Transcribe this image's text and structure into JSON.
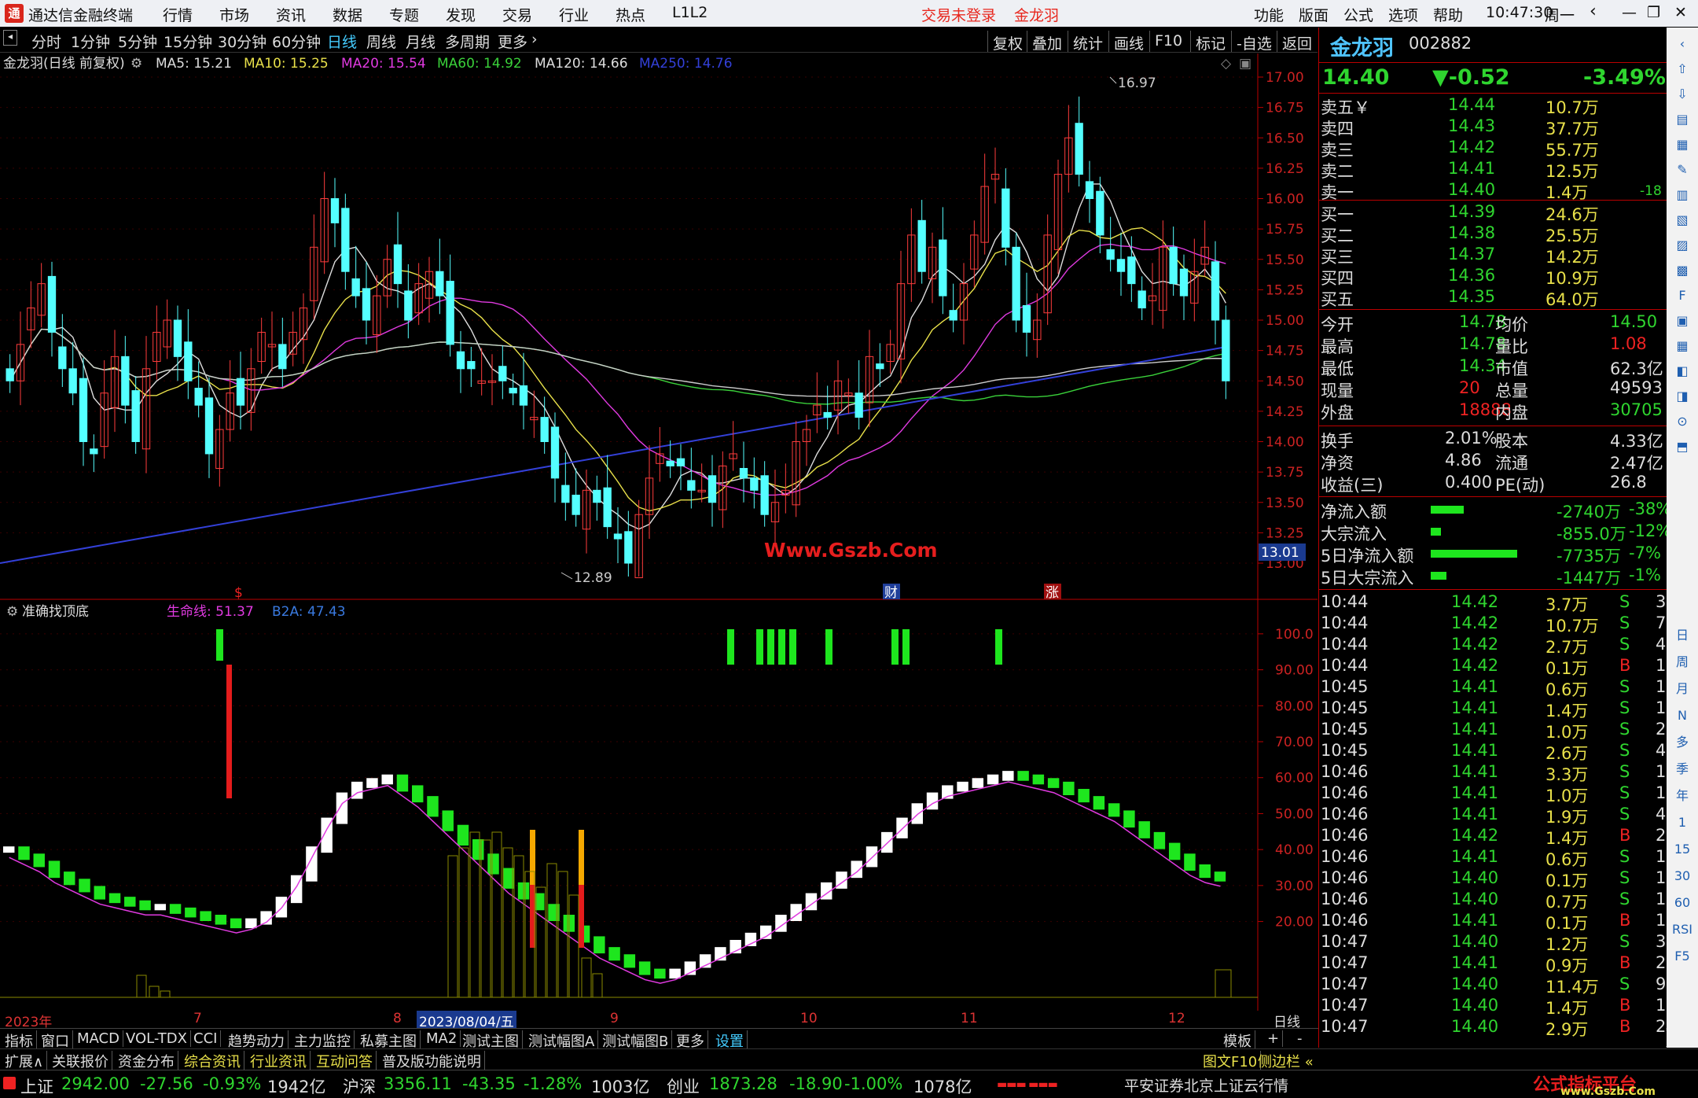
{
  "titlebar": {
    "app_title": "通达信金融终端",
    "menu": [
      "行情",
      "市场",
      "资讯",
      "数据",
      "专题",
      "发现",
      "交易",
      "行业",
      "热点",
      "L1L2"
    ],
    "login_status": "交易未登录",
    "stock_name": "金龙羽",
    "right_menu": [
      "功能",
      "版面",
      "公式",
      "选项",
      "帮助"
    ],
    "time": "10:47:30",
    "weekday": "周一"
  },
  "periods": [
    "分时",
    "1分钟",
    "5分钟",
    "15分钟",
    "30分钟",
    "60分钟",
    "日线",
    "周线",
    "月线",
    "多周期",
    "更多"
  ],
  "active_period": "日线",
  "toolbar_buttons": [
    "复权",
    "叠加",
    "统计",
    "画线",
    "F10",
    "标记",
    "-自选",
    "返回"
  ],
  "main_header": {
    "name": "金龙羽(日线 前复权)",
    "ma5": "MA5: 15.21",
    "ma10": "MA10: 15.25",
    "ma20": "MA20: 15.54",
    "ma60": "MA60: 14.92",
    "ma120": "MA120: 14.66",
    "ma250": "MA250: 14.76"
  },
  "y_axis_main": [
    "17.00",
    "16.75",
    "16.50",
    "16.25",
    "16.00",
    "15.75",
    "15.50",
    "15.25",
    "15.00",
    "14.75",
    "14.50",
    "14.25",
    "14.00",
    "13.75",
    "13.50",
    "13.25",
    "13.00"
  ],
  "price_marks": {
    "high": "16.97",
    "low": "12.89",
    "current": "13.01"
  },
  "watermark": "Www.Gszb.Com",
  "markers": {
    "m1": "$",
    "m2": "财",
    "m3": "涨"
  },
  "ind_header": {
    "name": "准确找顶底",
    "line1": "生命线: 51.37",
    "line2": "B2A: 47.43"
  },
  "y_axis_ind": [
    "100.0",
    "90.00",
    "80.00",
    "70.00",
    "60.00",
    "50.00",
    "40.00",
    "30.00",
    "20.00"
  ],
  "date_axis": {
    "year": "2023年",
    "months": [
      "7",
      "8",
      "9",
      "10",
      "11",
      "12"
    ],
    "cursor_date": "2023/08/04/五",
    "period_label": "日线"
  },
  "bottom_tabs": [
    "指标",
    "窗口",
    "MACD",
    "VOL-TDX",
    "CCI",
    "趋势动力",
    "主力监控",
    "私募主图",
    "MA2",
    "测试主图",
    "测试幅图A",
    "测试幅图B",
    "更多",
    "设置"
  ],
  "bottom_right": [
    "模板",
    "+",
    "-"
  ],
  "tabs2": [
    "扩展∧",
    "关联报价",
    "资金分布",
    "综合资讯",
    "行业资讯",
    "互动问答",
    "普及版功能说明"
  ],
  "tabs2_right": [
    "图文F10",
    "侧边栏 «"
  ],
  "quote_tabs": [
    "笔",
    "价",
    "细",
    "势",
    "联"
  ],
  "status": {
    "sh_label": "上证",
    "sh_val": "2942.00",
    "sh_chg": "-27.56",
    "sh_pct": "-0.93%",
    "sh_amt": "1942亿",
    "hs_label": "沪深",
    "hs_val": "3356.11",
    "hs_chg": "-43.35",
    "hs_pct": "-1.28%",
    "hs_amt": "1003亿",
    "cy_label": "创业",
    "cy_val": "1873.28",
    "cy_chg": "-18.90",
    "cy_pct": "-1.00%",
    "cy_amt": "1078亿",
    "broker": "平安证券北京上证云行情",
    "logo_text": "公式指标平台",
    "logo_url": "www.Gszb.Com"
  },
  "quote": {
    "name": "金龙羽",
    "code": "002882",
    "price": "14.40",
    "change": "▼-0.52",
    "pct": "-3.49%",
    "asks": [
      {
        "label": "卖五￥",
        "price": "14.44",
        "vol": "10.7万"
      },
      {
        "label": "卖四",
        "price": "14.43",
        "vol": "37.7万"
      },
      {
        "label": "卖三",
        "price": "14.42",
        "vol": "55.7万"
      },
      {
        "label": "卖二",
        "price": "14.41",
        "vol": "12.5万"
      },
      {
        "label": "卖一",
        "price": "14.40",
        "vol": "1.4万",
        "extra": "-18"
      }
    ],
    "bids": [
      {
        "label": "买一",
        "price": "14.39",
        "vol": "24.6万"
      },
      {
        "label": "买二",
        "price": "14.38",
        "vol": "25.5万"
      },
      {
        "label": "买三",
        "price": "14.37",
        "vol": "14.2万"
      },
      {
        "label": "买四",
        "price": "14.36",
        "vol": "10.9万"
      },
      {
        "label": "买五",
        "price": "14.35",
        "vol": "64.0万"
      }
    ],
    "stats": [
      [
        "今开",
        "14.78",
        "均价",
        "14.50"
      ],
      [
        "最高",
        "14.78",
        "量比",
        "1.08"
      ],
      [
        "最低",
        "14.34",
        "市值",
        "62.3亿"
      ],
      [
        "现量",
        "20",
        "总量",
        "49593"
      ],
      [
        "外盘",
        "18888",
        "内盘",
        "30705"
      ]
    ],
    "stats2": [
      [
        "换手",
        "2.01%",
        "股本",
        "4.33亿"
      ],
      [
        "净资",
        "4.86",
        "流通",
        "2.47亿"
      ],
      [
        "收益(三)",
        "0.400",
        "PE(动)",
        "26.8"
      ]
    ],
    "flows": [
      {
        "label": "净流入额",
        "val": "-2740万",
        "pct": "-38%",
        "bar": 0.38
      },
      {
        "label": "大宗流入",
        "val": "-855.0万",
        "pct": "-12%",
        "bar": 0.12
      },
      {
        "label": "5日净流入额",
        "val": "-7735万",
        "pct": "-7%",
        "bar": 1.0
      },
      {
        "label": "5日大宗流入",
        "val": "-1447万",
        "pct": "-1%",
        "bar": 0.18
      }
    ],
    "ticks": [
      [
        "10:44",
        "14.42",
        "3.7万",
        "S",
        "3"
      ],
      [
        "10:44",
        "14.42",
        "10.7万",
        "S",
        "7"
      ],
      [
        "10:44",
        "14.42",
        "2.7万",
        "S",
        "4"
      ],
      [
        "10:44",
        "14.42",
        "0.1万",
        "B",
        "1"
      ],
      [
        "10:45",
        "14.41",
        "0.6万",
        "S",
        "1"
      ],
      [
        "10:45",
        "14.41",
        "1.4万",
        "S",
        "1"
      ],
      [
        "10:45",
        "14.41",
        "1.0万",
        "S",
        "2"
      ],
      [
        "10:45",
        "14.41",
        "2.6万",
        "S",
        "4"
      ],
      [
        "10:46",
        "14.41",
        "3.3万",
        "S",
        "1"
      ],
      [
        "10:46",
        "14.41",
        "1.0万",
        "S",
        "1"
      ],
      [
        "10:46",
        "14.41",
        "1.9万",
        "S",
        "4"
      ],
      [
        "10:46",
        "14.42",
        "1.4万",
        "B",
        "2"
      ],
      [
        "10:46",
        "14.41",
        "0.6万",
        "S",
        "1"
      ],
      [
        "10:46",
        "14.40",
        "0.1万",
        "S",
        "1"
      ],
      [
        "10:46",
        "14.40",
        "0.7万",
        "S",
        "1"
      ],
      [
        "10:46",
        "14.41",
        "0.1万",
        "B",
        "1"
      ],
      [
        "10:47",
        "14.40",
        "1.2万",
        "S",
        "3"
      ],
      [
        "10:47",
        "14.41",
        "0.9万",
        "B",
        "2"
      ],
      [
        "10:47",
        "14.40",
        "11.4万",
        "S",
        "9"
      ],
      [
        "10:47",
        "14.40",
        "1.4万",
        "B",
        "1"
      ],
      [
        "10:47",
        "14.40",
        "2.9万",
        "B",
        "2"
      ]
    ]
  },
  "side_tools": [
    "日",
    "周",
    "月",
    "N",
    "多",
    "季",
    "年",
    "1",
    "15",
    "30",
    "60",
    "RSI",
    "F5"
  ],
  "chart_data": {
    "type": "candlestick",
    "ylim": [
      12.89,
      16.97
    ],
    "closes": [
      14.5,
      14.8,
      15.1,
      15.3,
      14.9,
      14.6,
      14.4,
      14.0,
      13.9,
      14.4,
      14.7,
      14.3,
      14.0,
      14.6,
      14.9,
      15.0,
      14.7,
      14.5,
      14.3,
      13.9,
      14.1,
      14.4,
      14.3,
      14.6,
      14.9,
      14.8,
      14.6,
      14.9,
      15.1,
      15.6,
      16.0,
      15.8,
      15.4,
      15.2,
      15.0,
      15.2,
      15.5,
      15.3,
      15.0,
      15.3,
      15.4,
      15.2,
      14.8,
      14.6,
      14.6,
      14.5,
      14.5,
      14.5,
      14.4,
      14.3,
      14.2,
      14.0,
      13.7,
      13.5,
      13.4,
      13.6,
      13.5,
      13.3,
      13.2,
      13.0,
      13.4,
      13.7,
      13.9,
      13.8,
      13.8,
      13.6,
      13.6,
      13.5,
      13.8,
      13.9,
      13.7,
      13.6,
      13.4,
      13.5,
      13.6,
      14.0,
      14.1,
      14.3,
      14.2,
      14.5,
      14.4,
      14.2,
      14.7,
      14.6,
      14.8,
      15.3,
      15.7,
      15.4,
      15.6,
      15.2,
      15.0,
      15.3,
      15.7,
      16.1,
      16.2,
      15.6,
      15.0,
      14.9,
      15.0,
      15.7,
      16.2,
      16.5,
      16.2,
      16.0,
      15.7,
      15.5,
      15.4,
      15.3,
      15.1,
      15.2,
      15.6,
      15.3,
      15.2,
      15.4,
      15.6,
      15.0,
      14.5
    ]
  }
}
